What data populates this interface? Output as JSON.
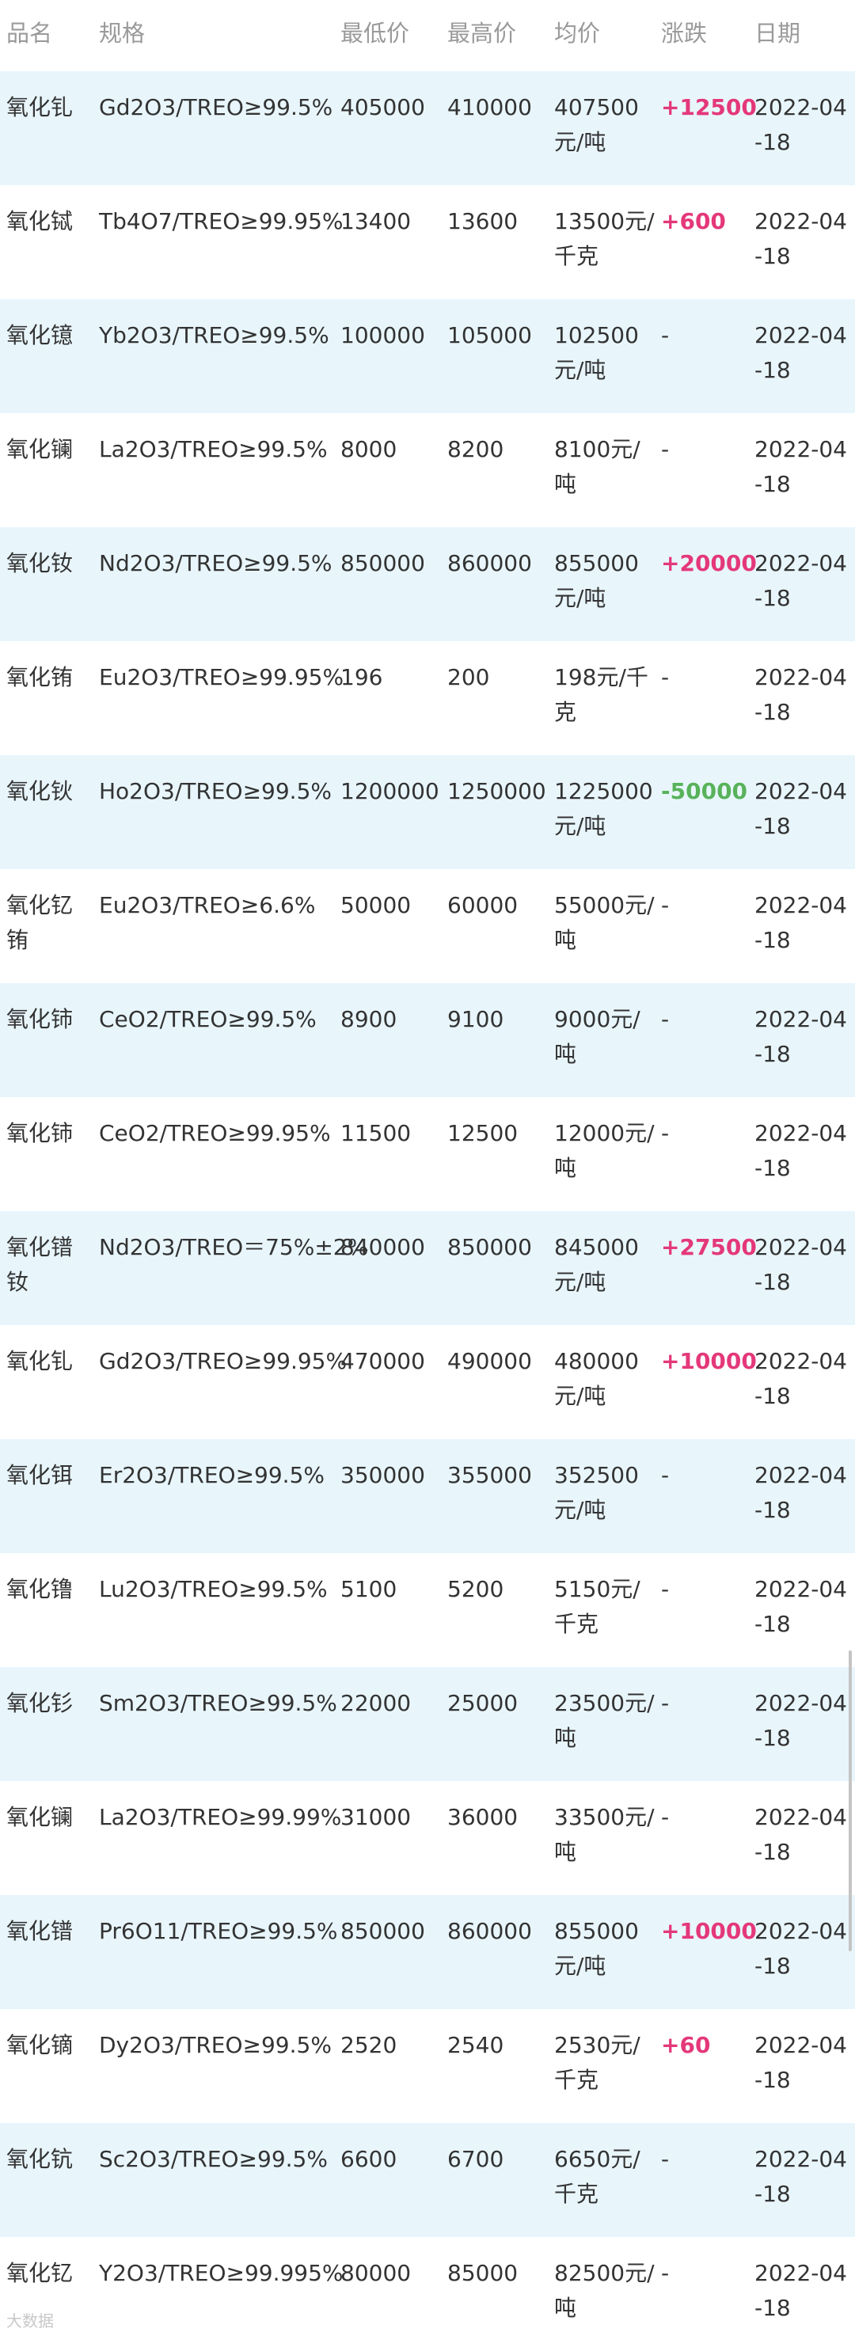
{
  "header": {
    "name": "品名",
    "spec": "规格",
    "min": "最低价",
    "max": "最高价",
    "avg": "均价",
    "change": "涨跌",
    "date": "日期"
  },
  "rows": [
    {
      "name": "氧化钆",
      "spec": "Gd2O3/TREO≥99.5%",
      "min": "405000",
      "max": "410000",
      "avg": "407500元/吨",
      "change": "+12500",
      "date": "2022-04-18"
    },
    {
      "name": "氧化铽",
      "spec": "Tb4O7/TREO≥99.95%",
      "min": "13400",
      "max": "13600",
      "avg": "13500元/千克",
      "change": "+600",
      "date": "2022-04-18"
    },
    {
      "name": "氧化镱",
      "spec": "Yb2O3/TREO≥99.5%",
      "min": "100000",
      "max": "105000",
      "avg": "102500元/吨",
      "change": "-",
      "date": "2022-04-18"
    },
    {
      "name": "氧化镧",
      "spec": "La2O3/TREO≥99.5%",
      "min": "8000",
      "max": "8200",
      "avg": "8100元/吨",
      "change": "-",
      "date": "2022-04-18"
    },
    {
      "name": "氧化钕",
      "spec": "Nd2O3/TREO≥99.5%",
      "min": "850000",
      "max": "860000",
      "avg": "855000元/吨",
      "change": "+20000",
      "date": "2022-04-18"
    },
    {
      "name": "氧化铕",
      "spec": "Eu2O3/TREO≥99.95%",
      "min": "196",
      "max": "200",
      "avg": "198元/千克",
      "change": "-",
      "date": "2022-04-18"
    },
    {
      "name": "氧化钬",
      "spec": "Ho2O3/TREO≥99.5%",
      "min": "1200000",
      "max": "1250000",
      "avg": "1225000元/吨",
      "change": "-50000",
      "date": "2022-04-18"
    },
    {
      "name": "氧化钇铕",
      "spec": "Eu2O3/TREO≥6.6%",
      "min": "50000",
      "max": "60000",
      "avg": "55000元/吨",
      "change": "-",
      "date": "2022-04-18"
    },
    {
      "name": "氧化铈",
      "spec": "CeO2/TREO≥99.5%",
      "min": "8900",
      "max": "9100",
      "avg": "9000元/吨",
      "change": "-",
      "date": "2022-04-18"
    },
    {
      "name": "氧化铈",
      "spec": "CeO2/TREO≥99.95%",
      "min": "11500",
      "max": "12500",
      "avg": "12000元/吨",
      "change": "-",
      "date": "2022-04-18"
    },
    {
      "name": "氧化镨钕",
      "spec": "Nd2O3/TREO＝75%±2%",
      "min": "840000",
      "max": "850000",
      "avg": "845000元/吨",
      "change": "+27500",
      "date": "2022-04-18"
    },
    {
      "name": "氧化钆",
      "spec": "Gd2O3/TREO≥99.95%",
      "min": "470000",
      "max": "490000",
      "avg": "480000元/吨",
      "change": "+10000",
      "date": "2022-04-18"
    },
    {
      "name": "氧化铒",
      "spec": "Er2O3/TREO≥99.5%",
      "min": "350000",
      "max": "355000",
      "avg": "352500元/吨",
      "change": "-",
      "date": "2022-04-18"
    },
    {
      "name": "氧化镥",
      "spec": "Lu2O3/TREO≥99.5%",
      "min": "5100",
      "max": "5200",
      "avg": "5150元/千克",
      "change": "-",
      "date": "2022-04-18"
    },
    {
      "name": "氧化钐",
      "spec": "Sm2O3/TREO≥99.5%",
      "min": "22000",
      "max": "25000",
      "avg": "23500元/吨",
      "change": "-",
      "date": "2022-04-18"
    },
    {
      "name": "氧化镧",
      "spec": "La2O3/TREO≥99.99%",
      "min": "31000",
      "max": "36000",
      "avg": "33500元/吨",
      "change": "-",
      "date": "2022-04-18"
    },
    {
      "name": "氧化镨",
      "spec": "Pr6O11/TREO≥99.5%",
      "min": "850000",
      "max": "860000",
      "avg": "855000元/吨",
      "change": "+10000",
      "date": "2022-04-18"
    },
    {
      "name": "氧化镝",
      "spec": "Dy2O3/TREO≥99.5%",
      "min": "2520",
      "max": "2540",
      "avg": "2530元/千克",
      "change": "+60",
      "date": "2022-04-18"
    },
    {
      "name": "氧化钪",
      "spec": "Sc2O3/TREO≥99.5%",
      "min": "6600",
      "max": "6700",
      "avg": "6650元/千克",
      "change": "-",
      "date": "2022-04-18"
    },
    {
      "name": "氧化钇",
      "spec": "Y2O3/TREO≥99.995%",
      "min": "80000",
      "max": "85000",
      "avg": "82500元/吨",
      "change": "-",
      "date": "2022-04-18"
    }
  ],
  "colors": {
    "alt_row": "#e8f6fc",
    "up": "#e4387a",
    "down": "#58b25a",
    "header_text": "#9a9a9a"
  },
  "watermark": "大数据"
}
